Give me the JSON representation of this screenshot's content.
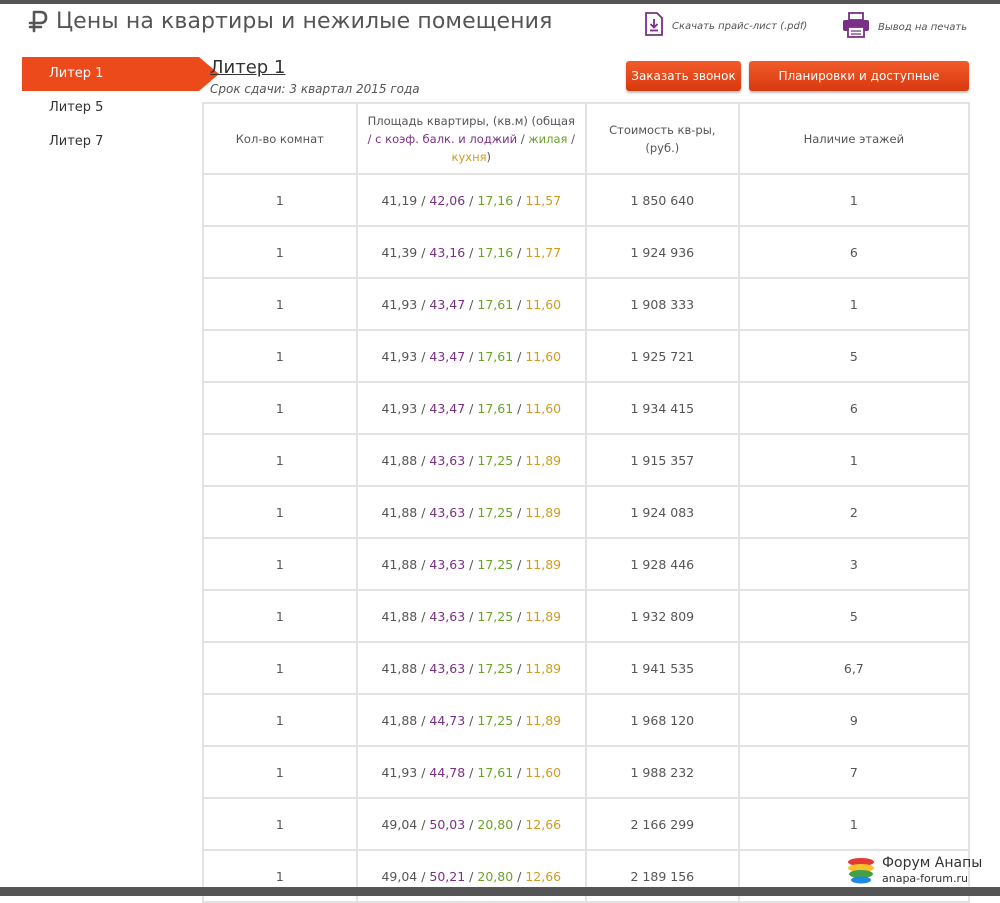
{
  "header": {
    "title": "Цены на квартиры и нежилые помещения",
    "download_label": "Скачать прайс-лист (.pdf)",
    "print_label": "Вывод на печать"
  },
  "sidebar": {
    "items": [
      {
        "label": "Литер 1",
        "active": true
      },
      {
        "label": "Литер 5",
        "active": false
      },
      {
        "label": "Литер 7",
        "active": false
      }
    ]
  },
  "section": {
    "title": "Литер 1",
    "deadline": "Срок сдачи: 3 квартал 2015 года"
  },
  "buttons": {
    "call": "Заказать звонок",
    "plans": "Планировки и доступные квартиры"
  },
  "table": {
    "headers": {
      "rooms": "Кол-во комнат",
      "area_prefix": "Площадь квартиры, (кв.м) (общая",
      "area_balk": "/ с коэф. балк. и лоджий",
      "area_live": "жилая",
      "area_kitchen": "кухня",
      "price": "Стоимость кв-ры, (руб.)",
      "floors": "Наличие этажей"
    },
    "rows": [
      {
        "rooms": "1",
        "total": "41,19",
        "balk": "42,06",
        "live": "17,16",
        "kitchen": "11,57",
        "price": "1 850 640",
        "floors": "1"
      },
      {
        "rooms": "1",
        "total": "41,39",
        "balk": "43,16",
        "live": "17,16",
        "kitchen": "11,77",
        "price": "1 924 936",
        "floors": "6"
      },
      {
        "rooms": "1",
        "total": "41,93",
        "balk": "43,47",
        "live": "17,61",
        "kitchen": "11,60",
        "price": "1 908 333",
        "floors": "1"
      },
      {
        "rooms": "1",
        "total": "41,93",
        "balk": "43,47",
        "live": "17,61",
        "kitchen": "11,60",
        "price": "1 925 721",
        "floors": "5"
      },
      {
        "rooms": "1",
        "total": "41,93",
        "balk": "43,47",
        "live": "17,61",
        "kitchen": "11,60",
        "price": "1 934 415",
        "floors": "6"
      },
      {
        "rooms": "1",
        "total": "41,88",
        "balk": "43,63",
        "live": "17,25",
        "kitchen": "11,89",
        "price": "1 915 357",
        "floors": "1"
      },
      {
        "rooms": "1",
        "total": "41,88",
        "balk": "43,63",
        "live": "17,25",
        "kitchen": "11,89",
        "price": "1 924 083",
        "floors": "2"
      },
      {
        "rooms": "1",
        "total": "41,88",
        "balk": "43,63",
        "live": "17,25",
        "kitchen": "11,89",
        "price": "1 928 446",
        "floors": "3"
      },
      {
        "rooms": "1",
        "total": "41,88",
        "balk": "43,63",
        "live": "17,25",
        "kitchen": "11,89",
        "price": "1 932 809",
        "floors": "5"
      },
      {
        "rooms": "1",
        "total": "41,88",
        "balk": "43,63",
        "live": "17,25",
        "kitchen": "11,89",
        "price": "1 941 535",
        "floors": "6,7"
      },
      {
        "rooms": "1",
        "total": "41,88",
        "balk": "44,73",
        "live": "17,25",
        "kitchen": "11,89",
        "price": "1 968 120",
        "floors": "9"
      },
      {
        "rooms": "1",
        "total": "41,93",
        "balk": "44,78",
        "live": "17,61",
        "kitchen": "11,60",
        "price": "1 988 232",
        "floors": "7"
      },
      {
        "rooms": "1",
        "total": "49,04",
        "balk": "50,03",
        "live": "20,80",
        "kitchen": "12,66",
        "price": "2 166 299",
        "floors": "1"
      },
      {
        "rooms": "1",
        "total": "49,04",
        "balk": "50,21",
        "live": "20,80",
        "kitchen": "12,66",
        "price": "2 189 156",
        "floors": ""
      }
    ]
  },
  "watermark": {
    "name": "Форум Анапы",
    "url": "anapa-forum.ru"
  },
  "colors": {
    "accent": "#ec4a1a",
    "balk": "#7a2f86",
    "live": "#6aa32a",
    "kitchen": "#d39a1e"
  }
}
